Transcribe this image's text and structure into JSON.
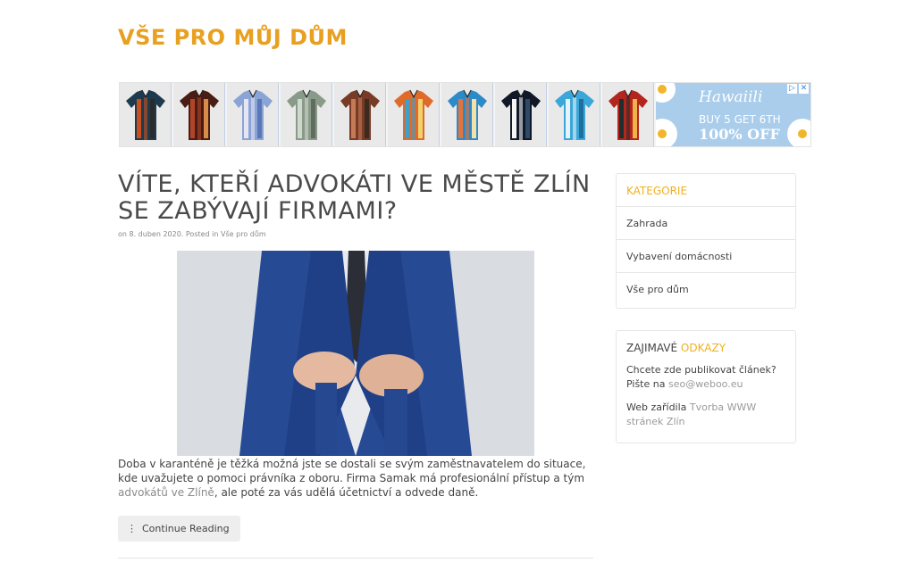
{
  "site": {
    "title": "VŠE PRO MŮJ DŮM"
  },
  "banner": {
    "brand": "Hawaiili",
    "line1": "BUY 5 GET 6TH",
    "line2": "100% OFF",
    "shirts": [
      {
        "colors": [
          "#1d3a4f",
          "#c8501f",
          "#2b2b2b"
        ]
      },
      {
        "colors": [
          "#4a1d14",
          "#b0452a",
          "#d98b48"
        ]
      },
      {
        "colors": [
          "#8aa4d6",
          "#e6e6f3",
          "#5a77b8"
        ]
      },
      {
        "colors": [
          "#8a9a8a",
          "#cfd8cc",
          "#5f6d5f"
        ]
      },
      {
        "colors": [
          "#7a3b26",
          "#c47b55",
          "#3b2a20"
        ]
      },
      {
        "colors": [
          "#e06a2a",
          "#3ea0c8",
          "#f1d26a"
        ]
      },
      {
        "colors": [
          "#2d8ac9",
          "#e3733a",
          "#f3e1a8"
        ]
      },
      {
        "colors": [
          "#111827",
          "#f5f5f5",
          "#2e4a6a"
        ]
      },
      {
        "colors": [
          "#3aa7d8",
          "#e7f3fa",
          "#1f6f9e"
        ]
      },
      {
        "colors": [
          "#b3261e",
          "#1f2f2f",
          "#f1b24a"
        ]
      }
    ],
    "colors": {
      "background": "#a9cdeb",
      "close": "#2a8ae0"
    }
  },
  "article": {
    "title": "VÍTE, KTEŘÍ ADVOKÁTI VE MĚSTĚ ZLÍN SE ZABÝVAJÍ FIRMAMI?",
    "meta_prefix": "on 8. duben 2020. Posted in ",
    "meta_category": "Vše pro dům",
    "excerpt_before": "Doba v karanténě je těžká možná jste se dostali se svým zaměstnavatelem do situace, kde uvažujete o pomoci právníka z oboru. Firma Samak má profesionální přístup a tým ",
    "excerpt_link": "advokátů ve Zlíně",
    "excerpt_after": ", ale poté za vás udělá účetnictví a odvede daně.",
    "read_more": "Continue Reading"
  },
  "sidebar": {
    "categories": {
      "title": "KATEGORIE",
      "items": [
        "Zahrada",
        "Vybavení domácnosti",
        "Vše pro dům"
      ]
    },
    "links": {
      "title_part1": "ZAJIMAVÉ ",
      "title_part2": "ODKAZY",
      "block1_text": "Chcete zde publikovat článek? Pište na ",
      "block1_link": "seo@weboo.eu",
      "block2_text": "Web zařídila ",
      "block2_link": "Tvorba WWW stránek Zlín"
    }
  },
  "colors": {
    "accent": "#e8a020",
    "yellow": "#f0b020",
    "text": "#444444",
    "link": "#8a8a8a"
  }
}
